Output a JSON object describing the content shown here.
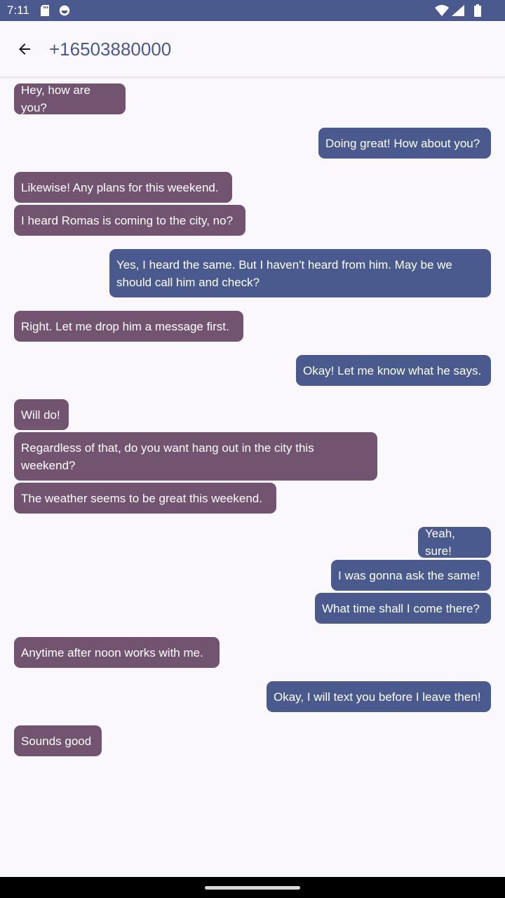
{
  "status_bar": {
    "time": "7:11",
    "left_icons": [
      "sd-card-icon",
      "sync-icon"
    ],
    "right_icons": [
      "wifi-icon",
      "signal-icon",
      "battery-icon"
    ]
  },
  "app_bar": {
    "back_icon": "arrow-back-icon",
    "title": "+16503880000"
  },
  "colors": {
    "incoming": "#725470",
    "outgoing": "#4a5a8f",
    "background": "#fbf8fd"
  },
  "messages": [
    {
      "dir": "in",
      "text": "Hey, how are you?"
    },
    {
      "dir": "out",
      "text": "Doing great! How about you?"
    },
    {
      "dir": "in",
      "text": "Likewise! Any plans for this weekend."
    },
    {
      "dir": "in",
      "text": "I heard Romas is coming to the city, no?"
    },
    {
      "dir": "out",
      "text": "Yes, I heard the same. But I haven't heard from him. May be we should call him and check?"
    },
    {
      "dir": "in",
      "text": "Right. Let me drop him a message first."
    },
    {
      "dir": "out",
      "text": "Okay! Let me know what he says."
    },
    {
      "dir": "in",
      "text": "Will do!"
    },
    {
      "dir": "in",
      "text": "Regardless of that, do you want hang out in the city this weekend?"
    },
    {
      "dir": "in",
      "text": "The weather seems to be great this weekend."
    },
    {
      "dir": "out",
      "text": "Yeah, sure!"
    },
    {
      "dir": "out",
      "text": "I was gonna ask the same!"
    },
    {
      "dir": "out",
      "text": "What time shall I come there?"
    },
    {
      "dir": "in",
      "text": "Anytime after noon works with me."
    },
    {
      "dir": "out",
      "text": "Okay, I will text you before I leave then!"
    },
    {
      "dir": "in",
      "text": "Sounds good"
    }
  ]
}
